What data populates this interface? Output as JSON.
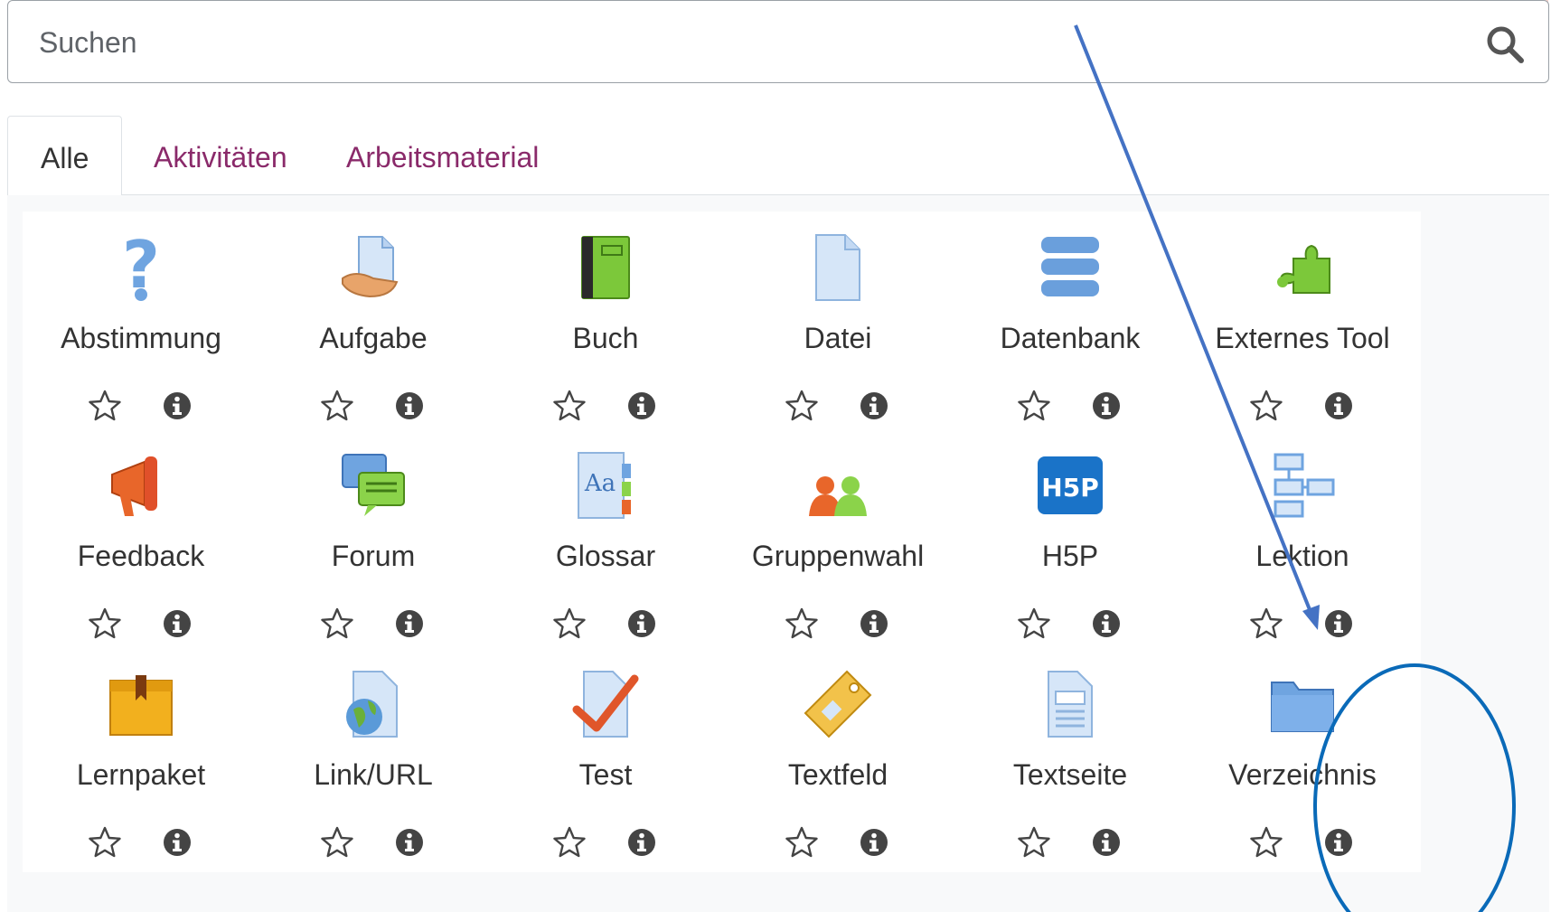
{
  "search": {
    "placeholder": "Suchen",
    "value": ""
  },
  "tabs": [
    {
      "label": "Alle",
      "active": true
    },
    {
      "label": "Aktivitäten",
      "active": false
    },
    {
      "label": "Arbeitsmaterial",
      "active": false
    }
  ],
  "modules": [
    {
      "label": "Abstimmung",
      "icon": "choice-question-icon"
    },
    {
      "label": "Aufgabe",
      "icon": "assignment-icon"
    },
    {
      "label": "Buch",
      "icon": "book-icon"
    },
    {
      "label": "Datei",
      "icon": "file-icon"
    },
    {
      "label": "Datenbank",
      "icon": "database-icon"
    },
    {
      "label": "Externes Tool",
      "icon": "puzzle-icon"
    },
    {
      "label": "Feedback",
      "icon": "megaphone-icon"
    },
    {
      "label": "Forum",
      "icon": "forum-icon"
    },
    {
      "label": "Glossar",
      "icon": "glossary-icon"
    },
    {
      "label": "Gruppenwahl",
      "icon": "group-icon"
    },
    {
      "label": "H5P",
      "icon": "h5p-icon"
    },
    {
      "label": "Lektion",
      "icon": "lesson-icon"
    },
    {
      "label": "Lernpaket",
      "icon": "package-icon"
    },
    {
      "label": "Link/URL",
      "icon": "url-icon"
    },
    {
      "label": "Test",
      "icon": "quiz-icon"
    },
    {
      "label": "Textfeld",
      "icon": "label-tag-icon"
    },
    {
      "label": "Textseite",
      "icon": "page-icon"
    },
    {
      "label": "Verzeichnis",
      "icon": "folder-icon"
    }
  ],
  "h5p_logo_text": "H5P",
  "glossary_icon_text": "Aa",
  "colors": {
    "tab_link": "#8a2a6a",
    "annotation": "#4472c4",
    "highlight_circle": "#0a6ab8"
  }
}
